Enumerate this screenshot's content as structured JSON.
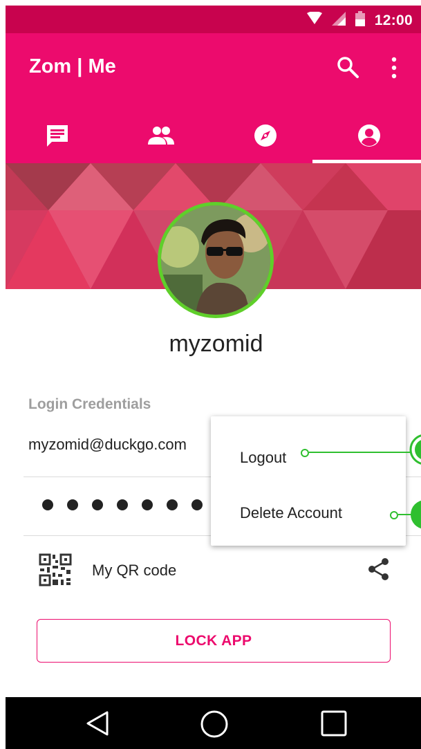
{
  "status_bar": {
    "time": "12:00",
    "icons": [
      "wifi-icon",
      "signal-icon",
      "battery-icon"
    ]
  },
  "app_bar": {
    "title": "Zom | Me",
    "actions": [
      "search-icon",
      "more-vert-icon"
    ]
  },
  "tabs": [
    {
      "icon": "chat-icon",
      "selected": false
    },
    {
      "icon": "people-icon",
      "selected": false
    },
    {
      "icon": "compass-icon",
      "selected": false
    },
    {
      "icon": "account-icon",
      "selected": true
    }
  ],
  "profile": {
    "username": "myzomid"
  },
  "credentials": {
    "section_label": "Login Credentials",
    "email": "myzomid@duckgo.com",
    "password_mask": "●●●●●●●"
  },
  "qr": {
    "label": "My QR code",
    "icons": [
      "qr-code-icon",
      "share-icon"
    ]
  },
  "lock_button": {
    "label": "LOCK APP"
  },
  "menu": {
    "items": [
      "Logout",
      "Delete Account"
    ]
  },
  "colors": {
    "primary": "#ec0b6d",
    "primary_dark": "#c8034e",
    "avatar_ring": "#5fcf2a",
    "callout": "#2fbf2f",
    "secondary_text": "#9e9e9e"
  },
  "nav_bar": {
    "buttons": [
      "back-icon",
      "home-icon",
      "recents-icon"
    ]
  }
}
